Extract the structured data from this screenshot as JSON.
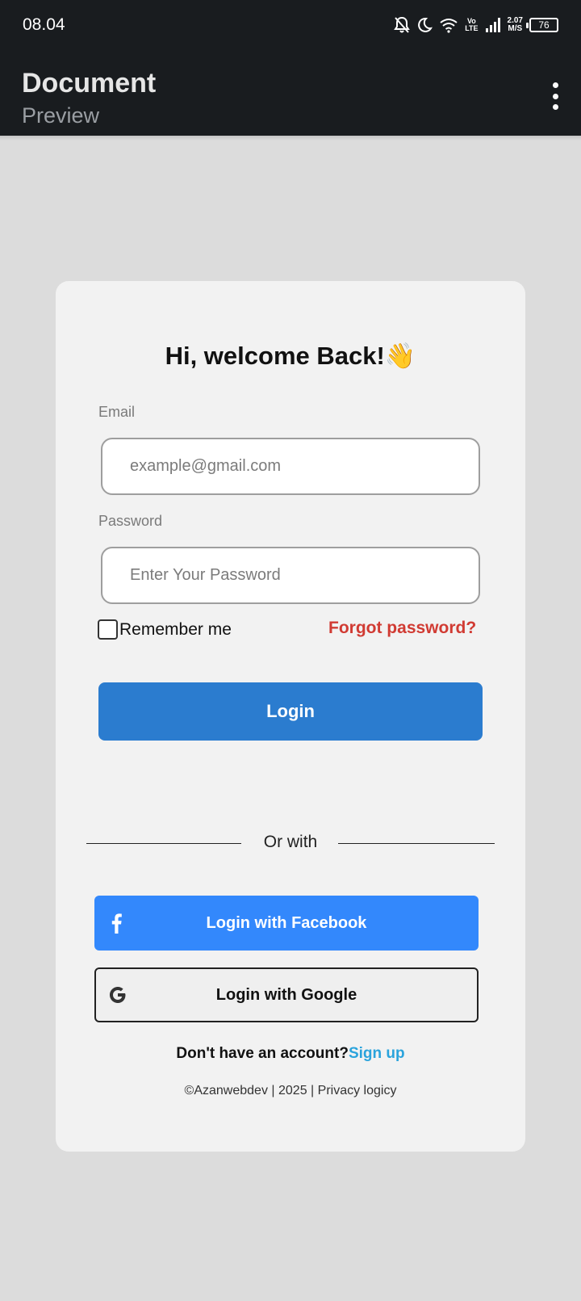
{
  "status_bar": {
    "time": "08.04",
    "volte_line1": "Vo",
    "volte_line2": "LTE",
    "net_speed_value": "2.07",
    "net_speed_unit": "M/S",
    "battery": "76"
  },
  "app_bar": {
    "title": "Document",
    "subtitle": "Preview",
    "menu_icon": "more-vert-icon"
  },
  "form": {
    "welcome": "Hi, welcome Back!👋",
    "email_label": "Email",
    "email_placeholder": "example@gmail.com",
    "email_value": "",
    "password_label": "Password",
    "password_placeholder": "Enter Your Password",
    "password_value": "",
    "remember_label": "Remember me",
    "remember_checked": false,
    "forgot_label": "Forgot password?",
    "login_label": "Login"
  },
  "social": {
    "or_with": "Or with",
    "facebook_label": "Login with Facebook",
    "google_label": "Login with Google"
  },
  "signup": {
    "prompt": "Don't have an account?",
    "link": "Sign up"
  },
  "footer": {
    "text": "©Azanwebdev | 2025 | Privacy logicy"
  },
  "colors": {
    "appbar_bg": "#191c1f",
    "page_bg": "#dcdcdc",
    "card_bg": "#f2f2f2",
    "login_button": "#2b7ccf",
    "facebook_button": "#3388fc",
    "forgot_link": "#d13b33",
    "signup_link": "#2aa3dc"
  }
}
